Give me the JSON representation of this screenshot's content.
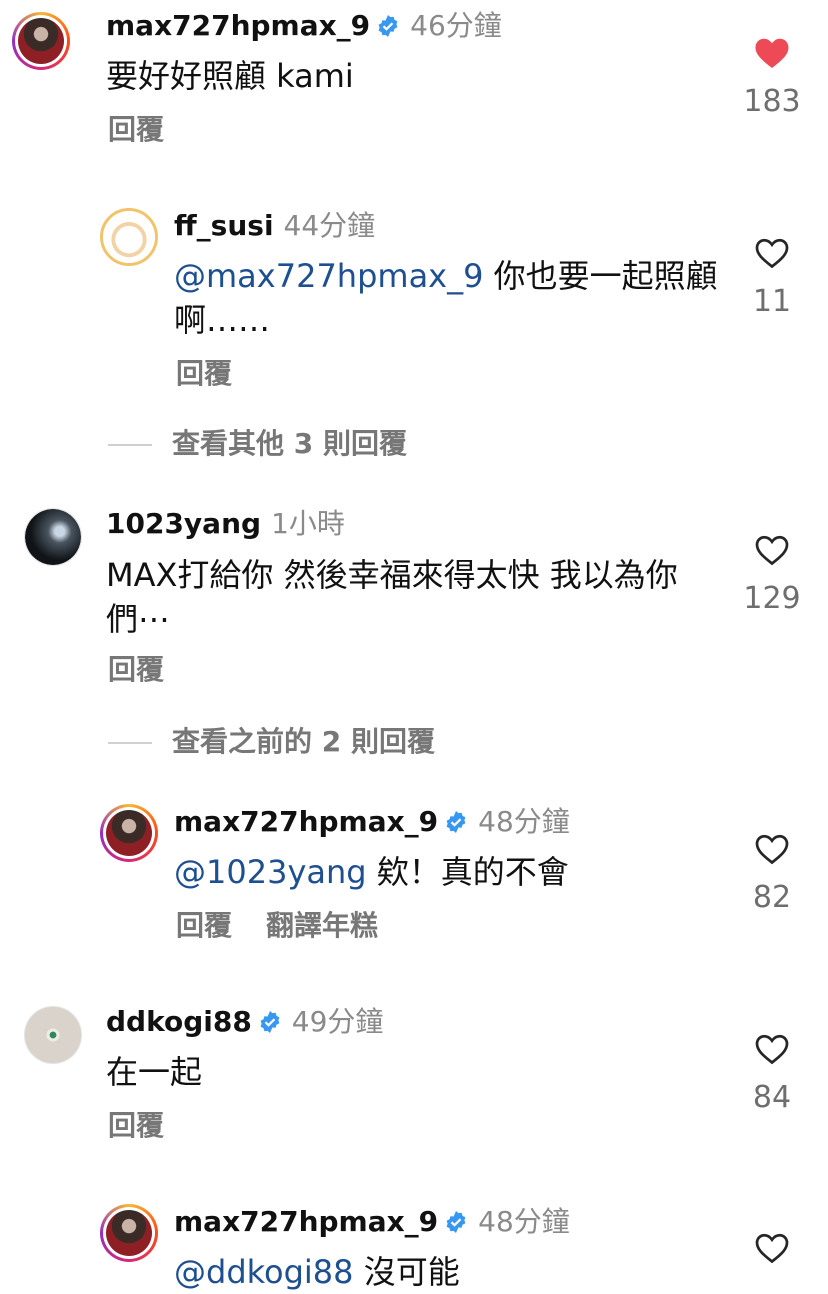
{
  "comments": [
    {
      "username": "max727hpmax_9",
      "verified": true,
      "time": "46分鐘",
      "text": "要好好照顧 kami",
      "mention": "",
      "reply_label": "回覆",
      "likes": "183",
      "liked": true
    },
    {
      "username": "ff_susi",
      "verified": false,
      "time": "44分鐘",
      "mention": "@max727hpmax_9",
      "text": " 你也要一起照顧啊……",
      "reply_label": "回覆",
      "likes": "11",
      "liked": false
    },
    {
      "username": "1023yang",
      "verified": false,
      "time": "1小時",
      "mention": "",
      "text": "MAX打給你 然後幸福來得太快 我以為你們⋯",
      "reply_label": "回覆",
      "likes": "129",
      "liked": false
    },
    {
      "username": "max727hpmax_9",
      "verified": true,
      "time": "48分鐘",
      "mention": "@1023yang",
      "text": " 欸！真的不會",
      "reply_label": "回覆",
      "translate_label": "翻譯年糕",
      "likes": "82",
      "liked": false
    },
    {
      "username": "ddkogi88",
      "verified": true,
      "time": "49分鐘",
      "mention": "",
      "text": "在一起",
      "reply_label": "回覆",
      "likes": "84",
      "liked": false
    },
    {
      "username": "max727hpmax_9",
      "verified": true,
      "time": "48分鐘",
      "mention": "@ddkogi88",
      "text": " 沒可能",
      "likes": "",
      "liked": false
    }
  ],
  "view_more": [
    "查看其他 3 則回覆",
    "查看之前的 2 則回覆"
  ],
  "colors": {
    "liked_heart": "#ed4956",
    "verified_badge": "#3897f0",
    "mention": "#1d4f91"
  }
}
